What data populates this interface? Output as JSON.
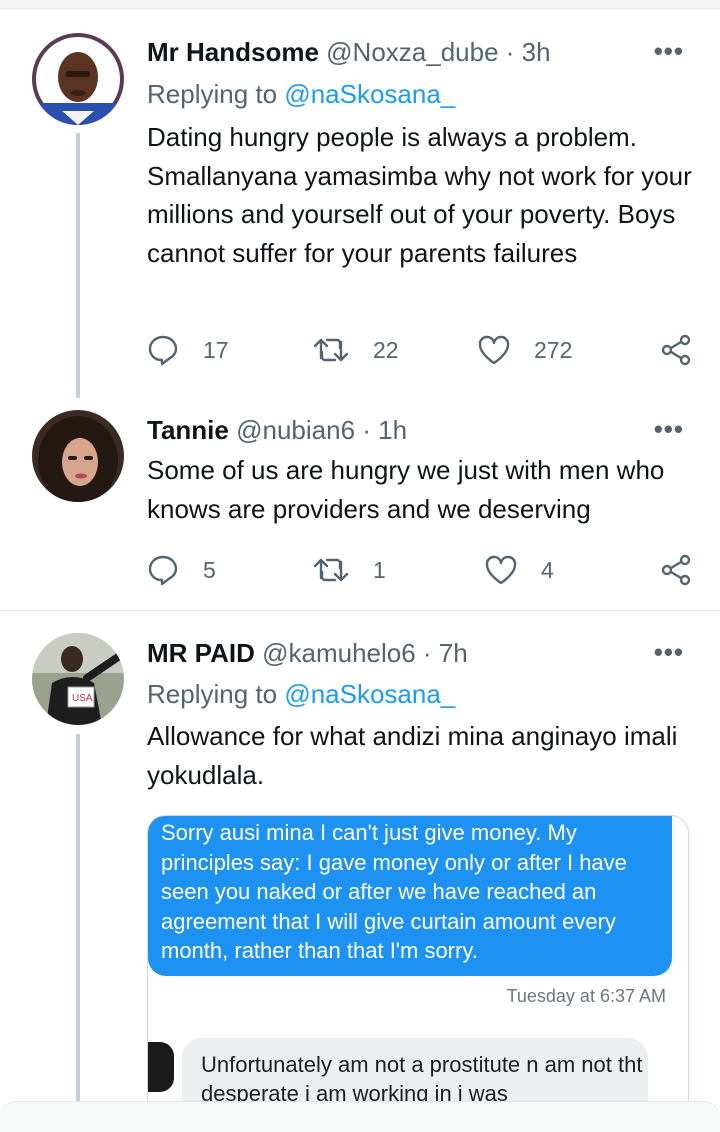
{
  "tweets": [
    {
      "name": "Mr Handsome",
      "handle": "@Noxza_dube",
      "time": "· 3h",
      "replying_prefix": "Replying to ",
      "replying_to": "@naSkosana_",
      "text": "Dating hungry people is always a problem. Smallanyana yamasimba why not work for your millions and yourself out of your poverty. Boys cannot suffer for your parents failures",
      "replies": "17",
      "retweets": "22",
      "likes": "272"
    },
    {
      "name": "Tannie",
      "handle": "@nubian6",
      "time": "· 1h",
      "text": "Some of us are hungry we just with men who knows are providers and we deserving",
      "replies": "5",
      "retweets": "1",
      "likes": "4"
    },
    {
      "name": "MR PAID",
      "handle": "@kamuhelo6",
      "time": "· 7h",
      "replying_prefix": "Replying to ",
      "replying_to": "@naSkosana_",
      "text": "Allowance for what andizi mina anginayo imali yokudlala.",
      "media": {
        "sent_message": "Sorry ausi mina I can't just give money. My principles  say: I gave money only or after I have seen you naked or after we have reached an agreement that I will give curtain amount every month, rather than that I'm sorry.",
        "timestamp": "Tuesday at 6:37 AM",
        "received_message": "Unfortunately  am not a prostitute n am not tht desperate  i am working in i was"
      }
    }
  ],
  "more_glyph": "•••",
  "icons": [
    "reply-icon",
    "retweet-icon",
    "like-icon",
    "share-icon",
    "more-icon"
  ],
  "colors": {
    "mention": "#1d9bf0",
    "secondary": "#536471",
    "bubble": "#1e92f3",
    "thread_line": "#c4cfd6"
  }
}
